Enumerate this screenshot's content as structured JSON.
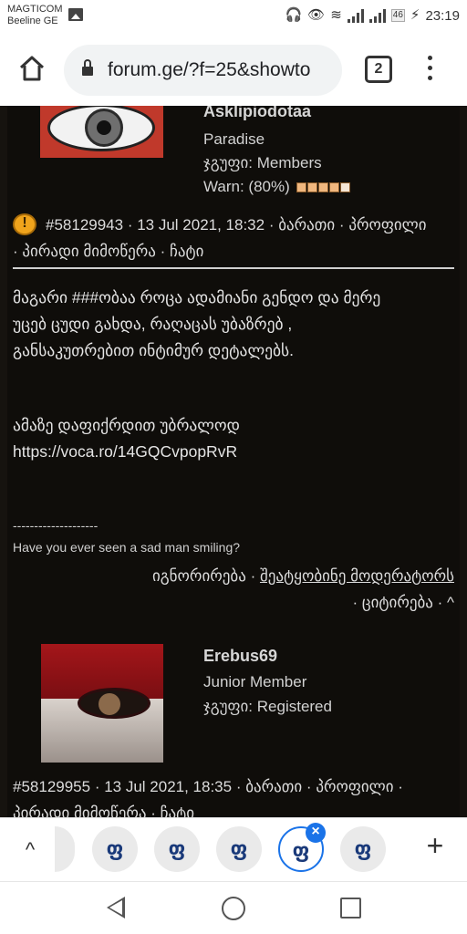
{
  "status_bar": {
    "carrier_line1": "MAGTICOM",
    "carrier_line2": "Beeline GE",
    "network_badge": "46",
    "time": "23:19"
  },
  "browser": {
    "url": "forum.ge/?f=25&showto",
    "tab_count": "2"
  },
  "post1": {
    "username": "Asklipiodotaa",
    "rank": "Paradise",
    "group": "ჯგუფი: Members",
    "warn": "Warn: (80%)",
    "warn_level": 0.8,
    "meta_line1": "#58129943 · 13 Jul 2021, 18:32 · ბარათი · პროფილი",
    "meta_line2": "· პირადი მიმოწერა · ჩატი",
    "body_line1": "მაგარი ###ობაა როცა ადამიანი გენდო და მერე",
    "body_line2": "უცებ ცუდი გახდა, რაღაცას უბაზრებ ,",
    "body_line3": "განსაკუთრებით ინტიმურ დეტალებს.",
    "body_line4": "ამაზე დაფიქრდით უბრალოდ",
    "body_line5": "https://voca.ro/14GQCvpopRvR",
    "sig_separator": "--------------------",
    "signature": "Have you ever seen a sad man smiling?",
    "action_ignore": "იგნორირება · ",
    "action_report": "შეატყობინე მოდერატორს",
    "action_line2": "· ციტირება · ^"
  },
  "post2": {
    "username": "Erebus69",
    "rank": "Junior Member",
    "group": "ჯგუფი: Registered",
    "meta_line1": "#58129955 · 13 Jul 2021, 18:35 · ბარათი · პროფილი ·",
    "meta_line2": "პირადი მიმოწერა · ჩატი"
  },
  "tab_strip": {
    "favicon_letter": "ფ",
    "collapse": "^",
    "close": "×",
    "new_tab": "+"
  }
}
